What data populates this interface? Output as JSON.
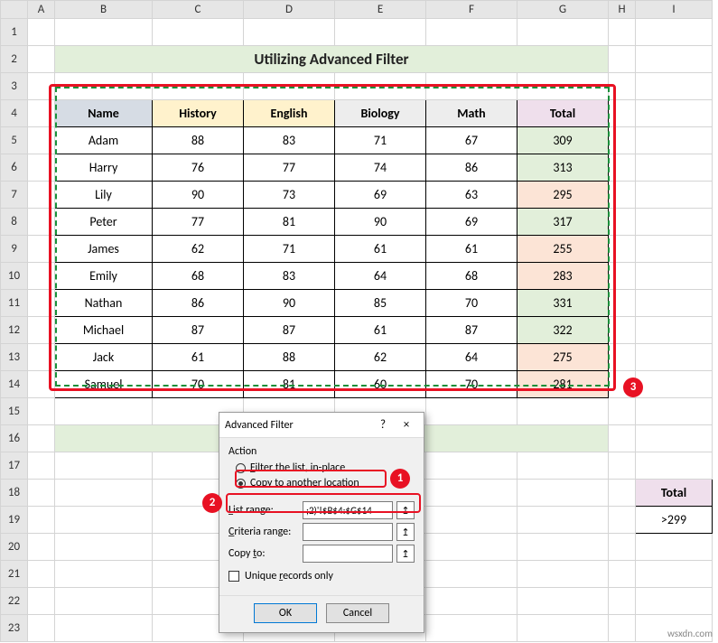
{
  "columns": [
    "A",
    "B",
    "C",
    "D",
    "E",
    "F",
    "G",
    "H",
    "I"
  ],
  "rows": [
    "1",
    "2",
    "3",
    "4",
    "5",
    "6",
    "7",
    "8",
    "9",
    "10",
    "11",
    "12",
    "13",
    "14",
    "15",
    "16",
    "17",
    "18",
    "19",
    "20",
    "21",
    "22",
    "23"
  ],
  "title": "Utilizing Advanced Filter",
  "headers": {
    "name": "Name",
    "history": "History",
    "english": "English",
    "biology": "Biology",
    "math": "Math",
    "total": "Total"
  },
  "data": [
    {
      "name": "Adam",
      "history": "88",
      "english": "83",
      "biology": "71",
      "math": "67",
      "total": "309",
      "cls": "green"
    },
    {
      "name": "Harry",
      "history": "76",
      "english": "77",
      "biology": "74",
      "math": "86",
      "total": "313",
      "cls": "green"
    },
    {
      "name": "Lily",
      "history": "90",
      "english": "73",
      "biology": "69",
      "math": "63",
      "total": "295",
      "cls": "pink"
    },
    {
      "name": "Peter",
      "history": "77",
      "english": "81",
      "biology": "90",
      "math": "69",
      "total": "317",
      "cls": "green"
    },
    {
      "name": "James",
      "history": "62",
      "english": "71",
      "biology": "61",
      "math": "61",
      "total": "255",
      "cls": "pink"
    },
    {
      "name": "Emily",
      "history": "68",
      "english": "83",
      "biology": "64",
      "math": "68",
      "total": "283",
      "cls": "pink"
    },
    {
      "name": "Nathan",
      "history": "86",
      "english": "90",
      "biology": "85",
      "math": "70",
      "total": "331",
      "cls": "green"
    },
    {
      "name": "Michael",
      "history": "87",
      "english": "87",
      "biology": "61",
      "math": "87",
      "total": "322",
      "cls": "green"
    },
    {
      "name": "Jack",
      "history": "61",
      "english": "88",
      "biology": "62",
      "math": "64",
      "total": "275",
      "cls": "pink"
    },
    {
      "name": "Samuel",
      "history": "70",
      "english": "81",
      "biology": "60",
      "math": "70",
      "total": "281",
      "cls": "pink"
    }
  ],
  "criteria": {
    "header": "Total",
    "value": ">299"
  },
  "dialog": {
    "title": "Advanced Filter",
    "help": "?",
    "close": "×",
    "action_label": "Action",
    "radio_inplace": "Filter the list, in-place",
    "radio_copy": "Copy to another location",
    "list_range_label": "List range:",
    "list_range_value": ";2)'!$B$4:$G$14",
    "criteria_label": "Criteria range:",
    "criteria_value": "",
    "copyto_label": "Copy to:",
    "copyto_value": "",
    "unique_label": "Unique records only",
    "ok": "OK",
    "cancel": "Cancel",
    "picker": "↥"
  },
  "callouts": {
    "c1": "1",
    "c2": "2",
    "c3": "3"
  },
  "watermark": "wsxdn.com"
}
